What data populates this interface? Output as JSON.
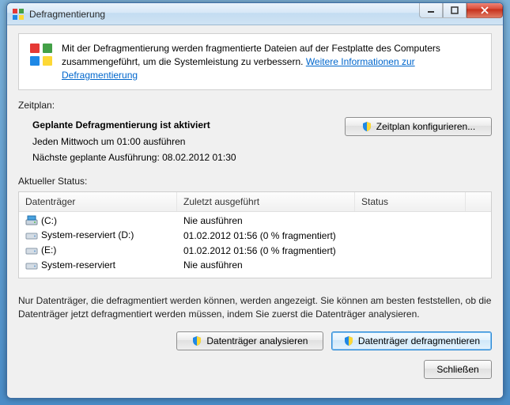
{
  "window": {
    "title": "Defragmentierung"
  },
  "info": {
    "text_part1": "Mit der Defragmentierung werden fragmentierte Dateien auf der Festplatte des Computers zusammengeführt, um die Systemleistung zu verbessern. ",
    "link_text": "Weitere Informationen zur Defragmentierung"
  },
  "schedule": {
    "section_label": "Zeitplan:",
    "status": "Geplante Defragmentierung ist aktiviert",
    "line1": "Jeden Mittwoch um 01:00 ausführen",
    "line2": "Nächste geplante Ausführung: 08.02.2012 01:30",
    "configure_btn": "Zeitplan konfigurieren..."
  },
  "status": {
    "section_label": "Aktueller Status:",
    "columns": {
      "drive": "Datenträger",
      "last_run": "Zuletzt ausgeführt",
      "status": "Status"
    },
    "rows": [
      {
        "icon": "main",
        "name": "(C:)",
        "last": "Nie ausführen",
        "status": ""
      },
      {
        "icon": "hdd",
        "name": "System-reserviert (D:)",
        "last": "01.02.2012 01:56 (0 % fragmentiert)",
        "status": ""
      },
      {
        "icon": "hdd",
        "name": "(E:)",
        "last": "01.02.2012 01:56 (0 % fragmentiert)",
        "status": ""
      },
      {
        "icon": "hdd",
        "name": "System-reserviert",
        "last": "Nie ausführen",
        "status": ""
      }
    ]
  },
  "note": "Nur Datenträger, die defragmentiert werden können, werden angezeigt. Sie können am besten feststellen, ob die Datenträger jetzt defragmentiert werden müssen, indem Sie zuerst die Datenträger analysieren.",
  "buttons": {
    "analyze": "Datenträger analysieren",
    "defrag": "Datenträger defragmentieren",
    "close": "Schließen"
  }
}
